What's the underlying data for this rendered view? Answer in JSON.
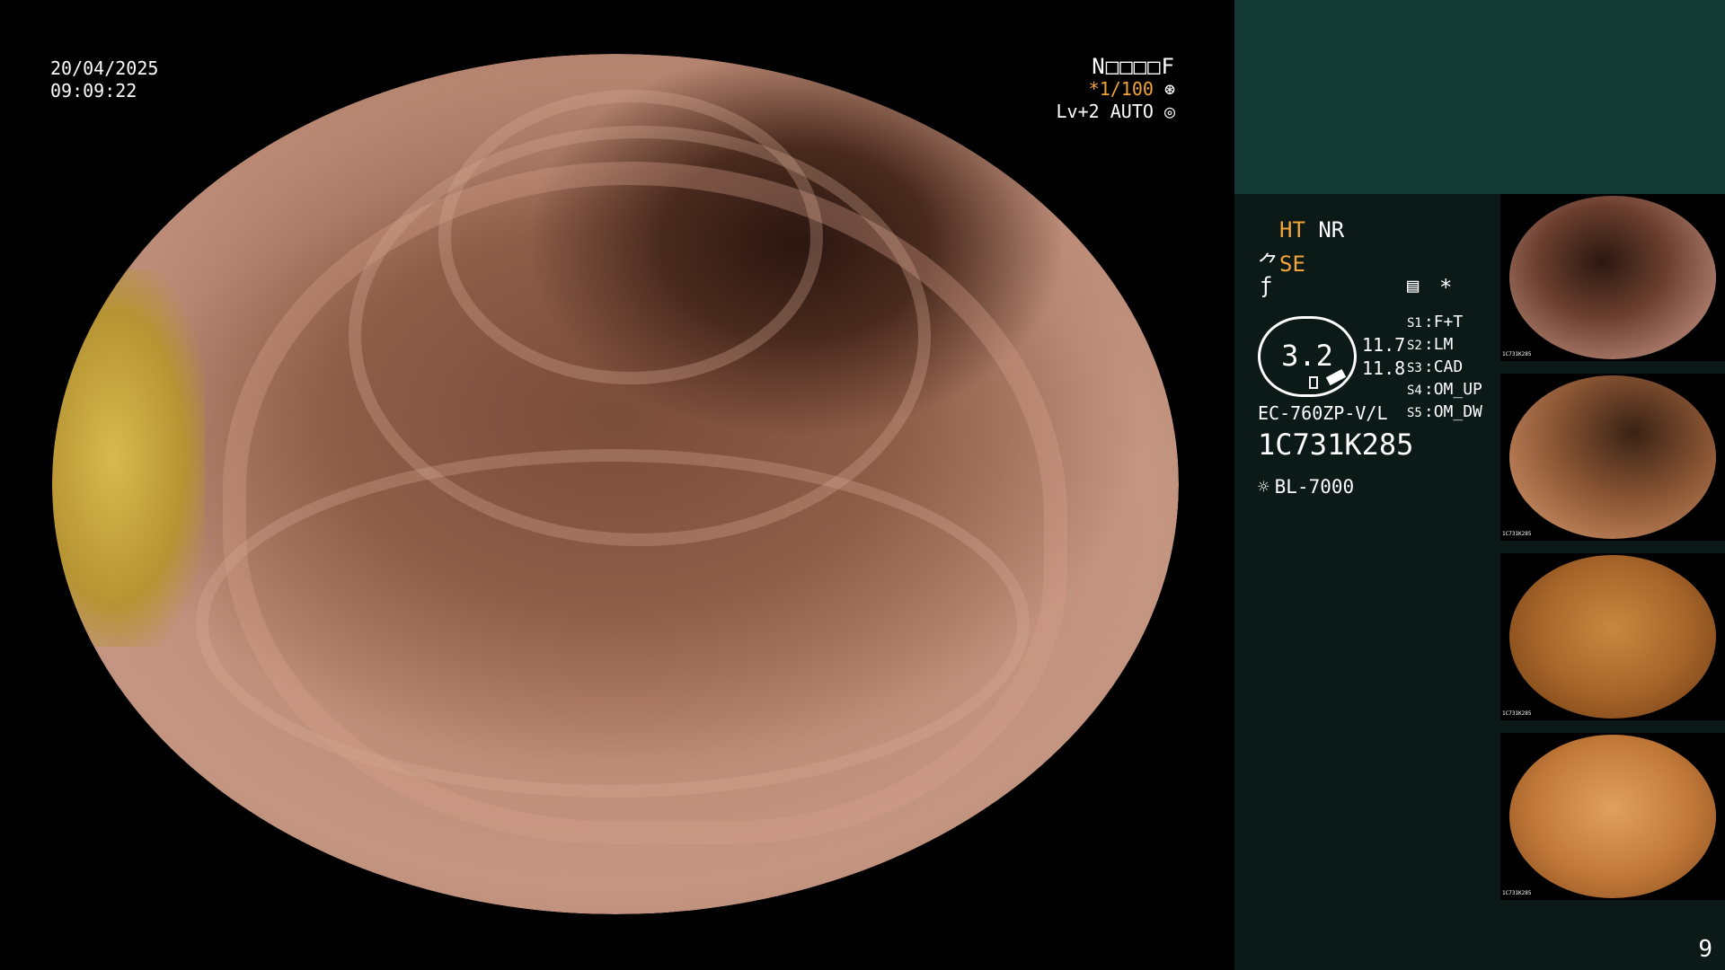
{
  "overlay": {
    "date": "20/04/2025",
    "time": "09:09:22",
    "patient_id": "N□□□□F",
    "shutter": "*1/100",
    "shutter_icon": "aperture-icon",
    "level": "Lv+2",
    "mode": "AUTO",
    "mode_icon": "auto-iris-icon"
  },
  "panel": {
    "ht": "HT",
    "nr": "NR",
    "se": "SE",
    "se_icon": "se-enhance-icon",
    "sharp_icon": "sharpness-icon",
    "notes_icon": "notes-icon",
    "star": "*",
    "gauge_value": "3.2",
    "gauge_val1": "11.7",
    "gauge_val2": "11.8",
    "slots": [
      {
        "key": "S1",
        "value": "F+T"
      },
      {
        "key": "S2",
        "value": "LM"
      },
      {
        "key": "S3",
        "value": "CAD"
      },
      {
        "key": "S4",
        "value": "OM_UP"
      },
      {
        "key": "S5",
        "value": "OM_DW"
      }
    ],
    "model": "EC-760ZP-V/L",
    "serial": "1C731K285",
    "light_icon": "light-source-icon",
    "light": "BL-7000",
    "page_number": "9"
  },
  "thumbnails": [
    {
      "label": "1C731K285"
    },
    {
      "label": "1C731K285"
    },
    {
      "label": "1C731K285"
    },
    {
      "label": "1C731K285"
    }
  ],
  "colors": {
    "accent_orange": "#f3a43a",
    "panel_top": "#133a35",
    "panel_bg": "#0b1a17"
  }
}
